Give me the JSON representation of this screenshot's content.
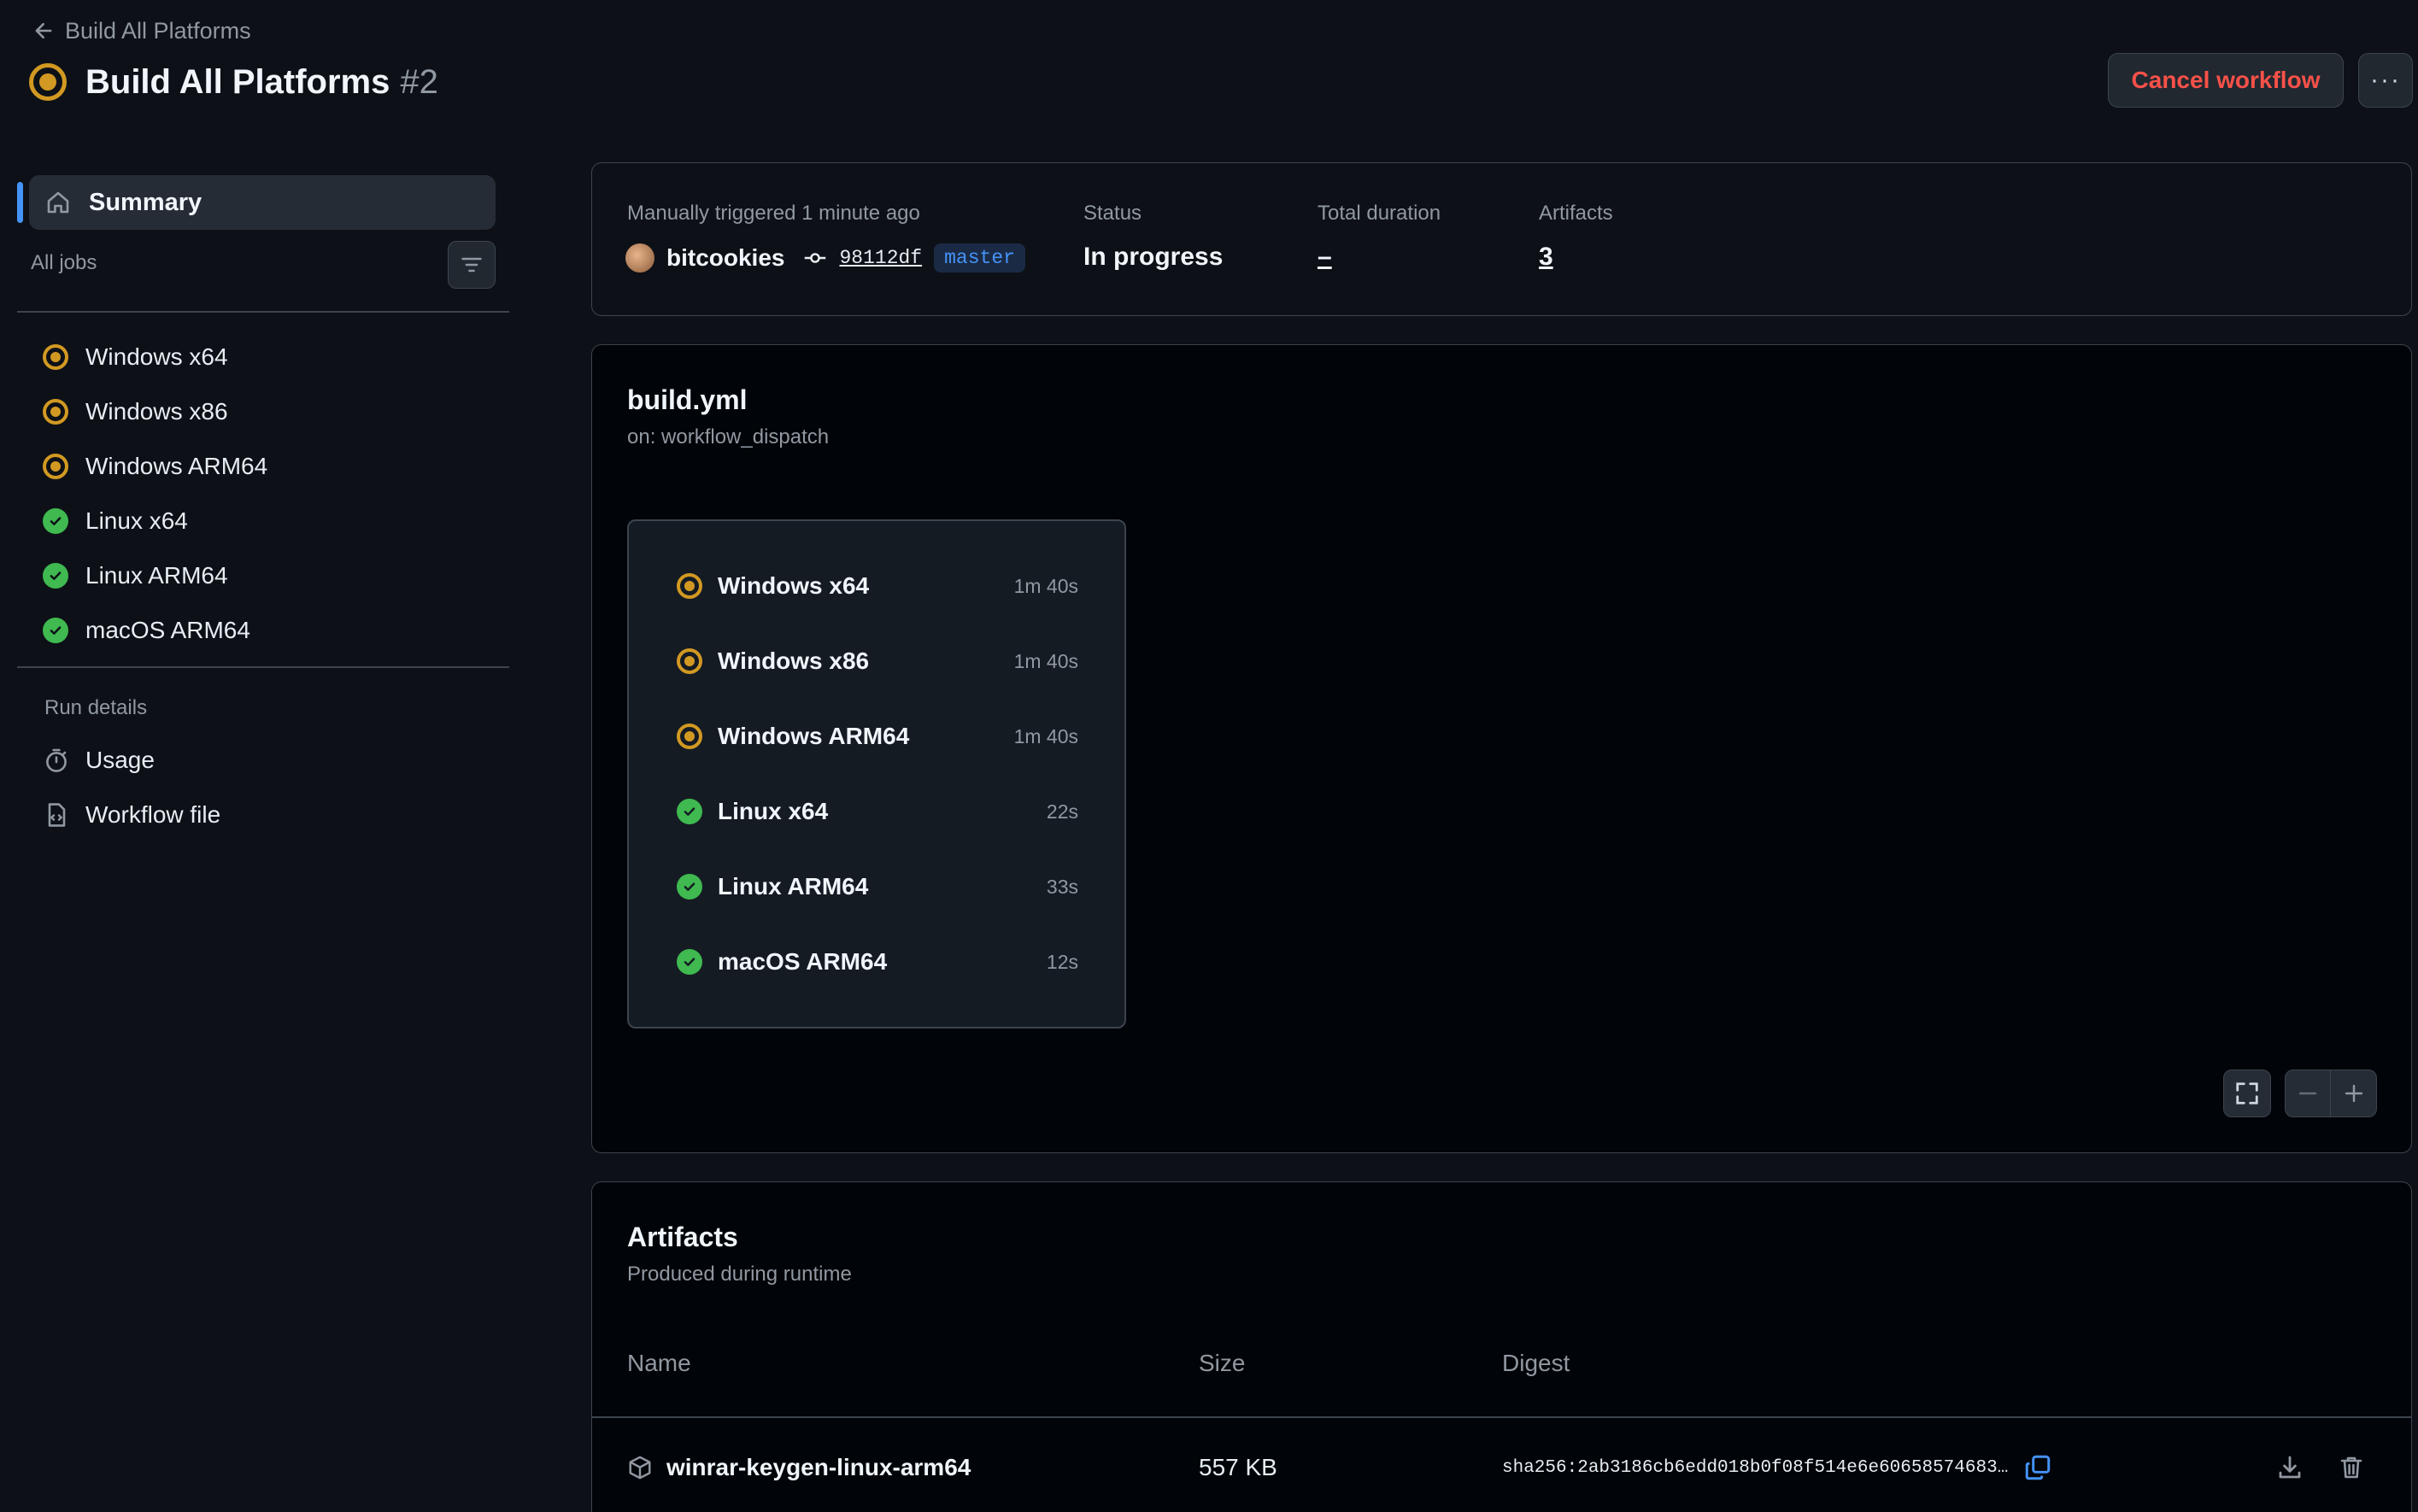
{
  "header": {
    "back_label": "Build All Platforms",
    "title": "Build All Platforms",
    "run_number": "#2",
    "cancel_label": "Cancel workflow",
    "more_label": "···"
  },
  "sidebar": {
    "summary_label": "Summary",
    "all_jobs_label": "All jobs",
    "jobs": [
      {
        "label": "Windows x64",
        "status": "in_progress"
      },
      {
        "label": "Windows x86",
        "status": "in_progress"
      },
      {
        "label": "Windows ARM64",
        "status": "in_progress"
      },
      {
        "label": "Linux x64",
        "status": "success"
      },
      {
        "label": "Linux ARM64",
        "status": "success"
      },
      {
        "label": "macOS ARM64",
        "status": "success"
      }
    ],
    "run_details_label": "Run details",
    "usage_label": "Usage",
    "workflow_file_label": "Workflow file"
  },
  "run_info": {
    "trigger_label": "Manually triggered 1 minute ago",
    "user": "bitcookies",
    "commit": "98112df",
    "branch": "master",
    "status_label": "Status",
    "status_value": "In progress",
    "duration_label": "Total duration",
    "duration_value": "–",
    "artifacts_label": "Artifacts",
    "artifacts_value": "3"
  },
  "graph": {
    "file": "build.yml",
    "trigger": "on: workflow_dispatch",
    "jobs": [
      {
        "label": "Windows x64",
        "duration": "1m 40s",
        "status": "in_progress"
      },
      {
        "label": "Windows x86",
        "duration": "1m 40s",
        "status": "in_progress"
      },
      {
        "label": "Windows ARM64",
        "duration": "1m 40s",
        "status": "in_progress"
      },
      {
        "label": "Linux x64",
        "duration": "22s",
        "status": "success"
      },
      {
        "label": "Linux ARM64",
        "duration": "33s",
        "status": "success"
      },
      {
        "label": "macOS ARM64",
        "duration": "12s",
        "status": "success"
      }
    ]
  },
  "artifacts": {
    "title": "Artifacts",
    "subtitle": "Produced during runtime",
    "columns": {
      "name": "Name",
      "size": "Size",
      "digest": "Digest"
    },
    "rows": [
      {
        "name": "winrar-keygen-linux-arm64",
        "size": "557 KB",
        "digest": "sha256:2ab3186cb6edd018b0f08f514e6e60658574683…"
      }
    ]
  },
  "colors": {
    "background": "#0d1117",
    "in_progress": "#d29922",
    "success": "#3fb950",
    "danger": "#f85149",
    "accent": "#4493f8"
  }
}
